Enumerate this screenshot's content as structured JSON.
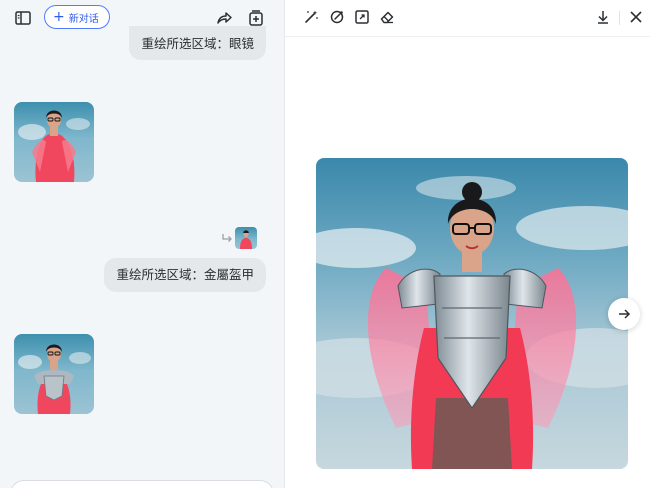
{
  "header": {
    "new_chat_label": "新对话",
    "new_chat_plus": "+"
  },
  "messages": [
    {
      "role": "user",
      "text": "重绘所选区域：眼镜"
    },
    {
      "role": "assistant",
      "type": "image",
      "subject": "woman-in-red-ruffled-dress"
    },
    {
      "role": "user",
      "text": "重绘所选区域：金屬盔甲",
      "has_reference_thumb": true
    },
    {
      "role": "assistant",
      "type": "image",
      "subject": "woman-in-metal-armor"
    }
  ],
  "preview": {
    "tools": [
      "magic-wand-icon",
      "repaint-icon",
      "expand-icon",
      "eraser-icon"
    ],
    "actions": [
      "download-icon",
      "close-icon"
    ],
    "next_icon": "arrow-right-icon"
  },
  "colors": {
    "accent": "#2f5bea",
    "chat_bg": "#f3f6f8",
    "bubble_bg": "#e4e8eb",
    "dress_red": "#f23a55",
    "sky_blue": "#3b88ab"
  }
}
